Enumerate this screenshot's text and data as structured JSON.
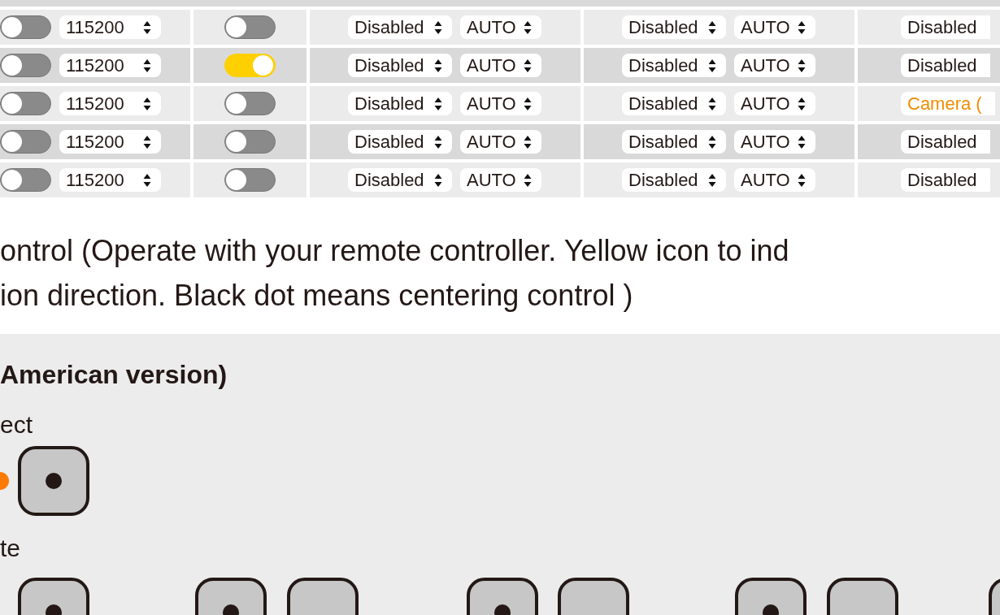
{
  "ports_table": {
    "rows": [
      {
        "toggle_1": false,
        "baud": "115200",
        "toggle_2": false,
        "group_a": {
          "mode": "Disabled",
          "speed": "AUTO"
        },
        "group_b": {
          "mode": "Disabled",
          "speed": "AUTO"
        },
        "peripheral": {
          "text": "Disabled",
          "highlighted": false
        }
      },
      {
        "toggle_1": false,
        "baud": "115200",
        "toggle_2": true,
        "group_a": {
          "mode": "Disabled",
          "speed": "AUTO"
        },
        "group_b": {
          "mode": "Disabled",
          "speed": "AUTO"
        },
        "peripheral": {
          "text": "Disabled",
          "highlighted": false
        }
      },
      {
        "toggle_1": false,
        "baud": "115200",
        "toggle_2": false,
        "group_a": {
          "mode": "Disabled",
          "speed": "AUTO"
        },
        "group_b": {
          "mode": "Disabled",
          "speed": "AUTO"
        },
        "peripheral": {
          "text": "Camera (",
          "highlighted": true
        }
      },
      {
        "toggle_1": false,
        "baud": "115200",
        "toggle_2": false,
        "group_a": {
          "mode": "Disabled",
          "speed": "AUTO"
        },
        "group_b": {
          "mode": "Disabled",
          "speed": "AUTO"
        },
        "peripheral": {
          "text": "Disabled",
          "highlighted": false
        }
      },
      {
        "toggle_1": false,
        "baud": "115200",
        "toggle_2": false,
        "group_a": {
          "mode": "Disabled",
          "speed": "AUTO"
        },
        "group_b": {
          "mode": "Disabled",
          "speed": "AUTO"
        },
        "peripheral": {
          "text": "Disabled",
          "highlighted": false
        }
      }
    ]
  },
  "instructions": {
    "lines": [
      "ontrol (Operate with your remote controller. Yellow icon to ind",
      "ion direction. Black dot means centering control )"
    ]
  },
  "controls_section": {
    "heading": "American version)",
    "groups": [
      {
        "label": "ect"
      },
      {
        "label": "te"
      }
    ]
  }
}
